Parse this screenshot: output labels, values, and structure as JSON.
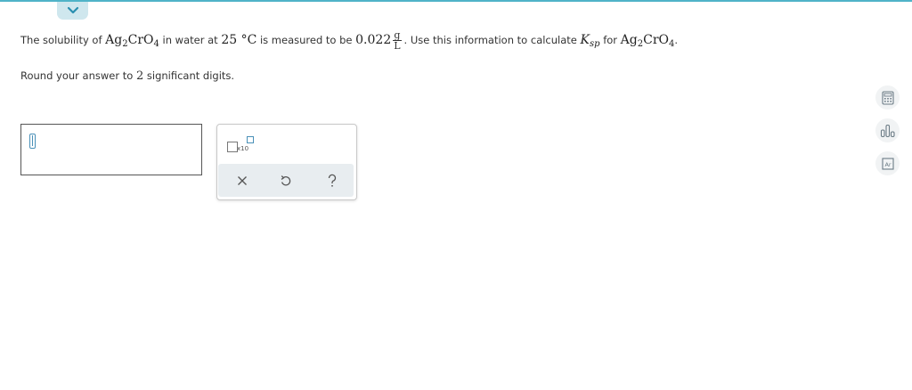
{
  "question": {
    "solubility_label": "The solubility of",
    "compound_main": "Ag",
    "compound_sub1": "2",
    "compound_mid": "CrO",
    "compound_sub2": "4",
    "in_water_at": "in water at",
    "temperature": "25 °C",
    "measured_to_be": "is measured to be",
    "value": "0.022",
    "unit_numerator": "g",
    "unit_denominator": "L",
    "period1": ".",
    "use_text": "Use this information to calculate",
    "ksp_symbol": "K",
    "ksp_subscript": "sp",
    "for_text": "for",
    "period2": "."
  },
  "instruction": {
    "before": "Round your answer to",
    "digits": "2",
    "after": "significant digits."
  },
  "answer": {
    "value": ""
  },
  "toolbox": {
    "sci_label": "x10"
  },
  "icons": {
    "collapse": "chevron-down-icon",
    "calculator": "calculator-icon",
    "chart": "bar-chart-icon",
    "periodic_table": "periodic-table-icon",
    "clear": "close-icon",
    "undo": "undo-icon",
    "help": "question-icon"
  },
  "periodic": {
    "element_symbol": "Ar"
  },
  "colors": {
    "accent": "#4fb3c8",
    "tab_bg": "#cfe7ee",
    "chevron": "#2a8fb0",
    "icon": "#6b7b85"
  }
}
